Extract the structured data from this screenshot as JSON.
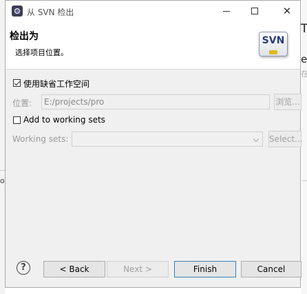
{
  "window": {
    "title": "从 SVN 检出",
    "close_glyph": "✕"
  },
  "header": {
    "title": "检出为",
    "subtitle": "选择项目位置。",
    "logo_text": "SVN"
  },
  "location": {
    "use_default_label": "使用缺省工作空间",
    "use_default_checked": true,
    "location_label": "位置:",
    "location_value": "E:/projects/pro",
    "browse_label": "浏览..."
  },
  "working_sets": {
    "add_label": "Add to working sets",
    "add_checked": false,
    "label": "Working sets:",
    "value": "",
    "select_label": "Select..."
  },
  "footer": {
    "help_glyph": "?",
    "back_label": "< Back",
    "next_label": "Next >",
    "finish_label": "Finish",
    "cancel_label": "Cancel"
  },
  "background": {
    "right_t": "T",
    "right_e": "e",
    "right_g": "在",
    "left_ol": "ola"
  },
  "colors": {
    "dialog_bg": "#f0f0f0",
    "primary_border": "#3c7fb1"
  }
}
